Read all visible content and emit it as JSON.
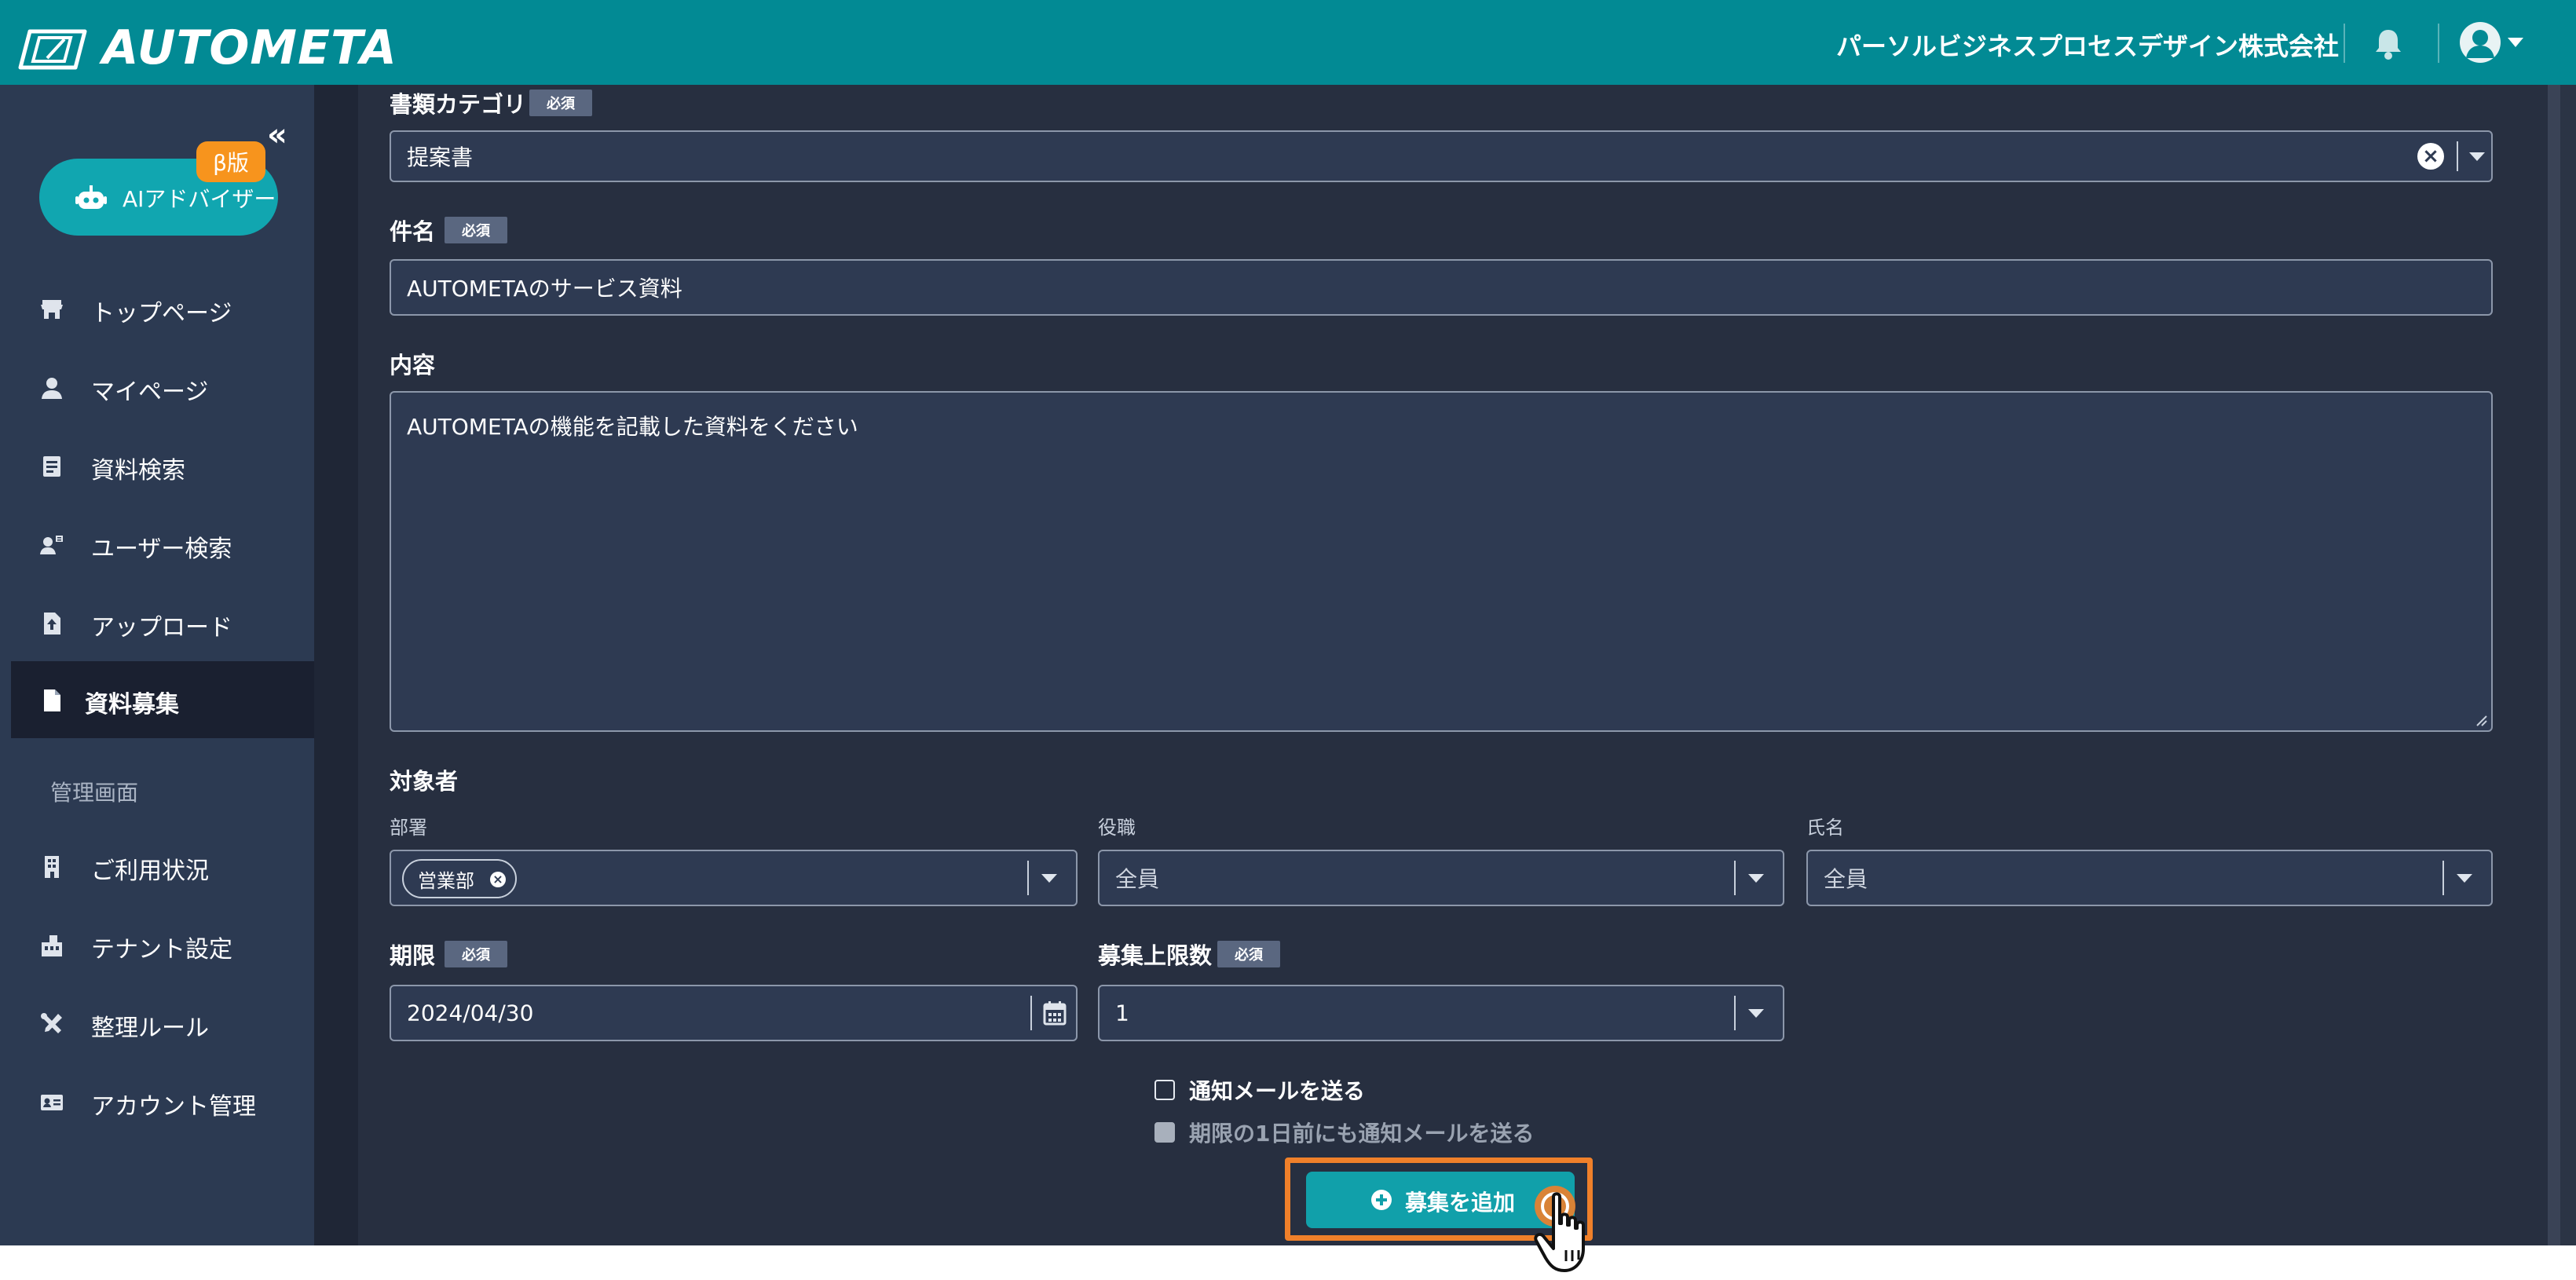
{
  "app": {
    "logo_text": "AUTOMETA",
    "company": "パーソルビジネスプロセスデザイン株式会社"
  },
  "sidebar": {
    "ai_button_label": "AIアドバイザー",
    "beta_badge": "β版",
    "items": [
      {
        "label": "トップページ",
        "icon": "store-icon"
      },
      {
        "label": "マイページ",
        "icon": "person-icon"
      },
      {
        "label": "資料検索",
        "icon": "document-search-icon"
      },
      {
        "label": "ユーザー検索",
        "icon": "user-search-icon"
      },
      {
        "label": "アップロード",
        "icon": "upload-file-icon"
      },
      {
        "label": "資料募集",
        "icon": "file-icon",
        "active": true
      }
    ],
    "admin_section_label": "管理画面",
    "admin_items": [
      {
        "label": "ご利用状況",
        "icon": "building-icon"
      },
      {
        "label": "テナント設定",
        "icon": "tenant-icon"
      },
      {
        "label": "整理ルール",
        "icon": "tools-icon"
      },
      {
        "label": "アカウント管理",
        "icon": "id-card-icon"
      }
    ]
  },
  "form": {
    "required_badge": "必須",
    "category": {
      "label": "書類カテゴリ",
      "value": "提案書"
    },
    "subject": {
      "label": "件名",
      "value": "AUTOMETAのサービス資料"
    },
    "content": {
      "label": "内容",
      "value": "AUTOMETAの機能を記載した資料をください"
    },
    "target": {
      "label": "対象者",
      "department": {
        "label": "部署",
        "chip": "営業部"
      },
      "position": {
        "label": "役職",
        "value": "全員"
      },
      "name": {
        "label": "氏名",
        "value": "全員"
      }
    },
    "deadline": {
      "label": "期限",
      "value": "2024/04/30"
    },
    "limit": {
      "label": "募集上限数",
      "value": "1"
    },
    "notify_mail": {
      "label": "通知メールを送る",
      "checked": false
    },
    "notify_before": {
      "label": "期限の1日前にも通知メールを送る",
      "checked": false,
      "disabled": true
    },
    "add_button_label": "募集を追加"
  },
  "colors": {
    "header": "#028a94",
    "sidebar": "#2c3a52",
    "main_bg": "#272f40",
    "accent": "#11a0aa",
    "beta": "#f7941d",
    "highlight": "#f0802a"
  }
}
